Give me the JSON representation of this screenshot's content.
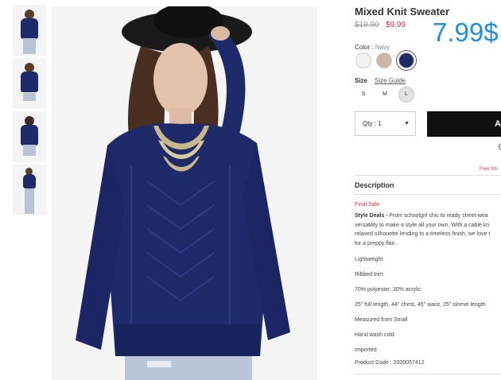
{
  "product": {
    "title": "Mixed Knit Sweater",
    "price_original": "$19.90",
    "price_sale": "$9.99",
    "price_overlay": "7.99$"
  },
  "color": {
    "label": "Color :",
    "selected": "Navy",
    "swatches": [
      {
        "name": "White",
        "hex": "#f2f2f2"
      },
      {
        "name": "Oatmeal",
        "hex": "#c9b7a6"
      },
      {
        "name": "Navy",
        "hex": "#1f2a6b"
      }
    ]
  },
  "size": {
    "label": "Size",
    "guide": "Size Guide",
    "options": [
      "S",
      "M",
      "L"
    ],
    "selected": "L"
  },
  "cart": {
    "qty_label": "Qty : 1",
    "add_label": "A"
  },
  "shipping": {
    "text": "Free Shi"
  },
  "description": {
    "heading": "Description",
    "final_sale": "Final Sale",
    "style_deals_lead": "Style Deals -",
    "style_deals_lines": [
      " From schoolgirl chic to ready street-wea",
      "versatility to make a style all your own. With a cable kn",
      "relaxed silhouette lending to a timeless finish, we love t",
      "for a preppy flair."
    ],
    "details": [
      "Lightweight",
      "Ribbed trim",
      "70% polyester, 30% acrylic",
      "25\" full length, 44\" chest, 45\" waist, 25\" sleeve length",
      "Measured from Small",
      "Hand wash cold",
      "Imported",
      "Product Code : 2000057412"
    ]
  },
  "colors": {
    "price_blue": "#1d8fe6",
    "sale_red": "#e0323b",
    "sweater_navy": "#1f2a6b"
  }
}
